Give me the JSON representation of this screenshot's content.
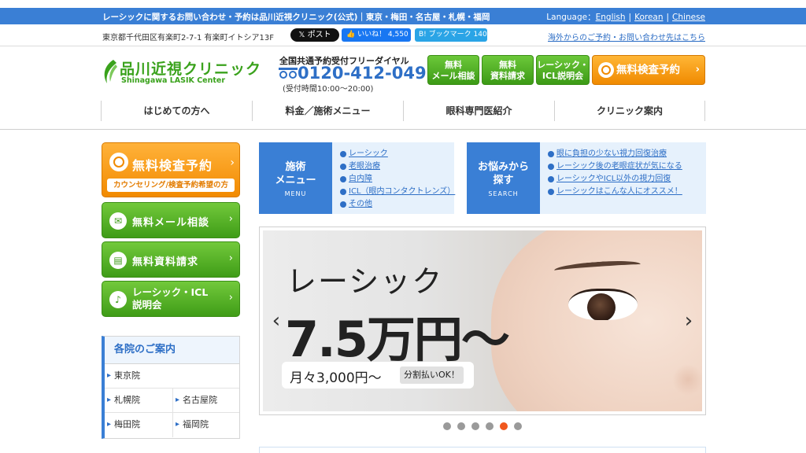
{
  "topbar": {
    "tagline": "レーシックに関するお問い合わせ・予約は品川近視クリニック(公式)｜東京・梅田・名古屋・札幌・福岡",
    "language_label": "Language：",
    "languages": [
      "English",
      "Korean",
      "Chinese"
    ],
    "separator": "|"
  },
  "inforow": {
    "address": "東京都千代田区有楽町2-7-1 有楽町イトシア13F",
    "x_post": "𝕏 ポスト",
    "fb_like": "👍 いいね！ 4,550",
    "hatena": "B! ブックマーク 140",
    "overseas_link": "海外からのご予約・お問い合わせ先はこちら"
  },
  "header": {
    "logo_jp": "品川近視クリニック",
    "logo_en": "Shinagawa LASIK Center",
    "dial_label": "全国共通予約受付フリーダイヤル",
    "dial_number": "0120-412-049",
    "dial_hours": "(受付時間10:00〜20:00)",
    "buttons": [
      {
        "line1": "無料",
        "line2": "メール相談"
      },
      {
        "line1": "無料",
        "line2": "資料請求"
      },
      {
        "line1": "レーシック・",
        "line2": "ICL説明会"
      }
    ],
    "main_button": "無料検査予約",
    "arrow": "›"
  },
  "nav": {
    "items": [
      "はじめての方へ",
      "料金／施術メニュー",
      "眼科専門医紹介",
      "クリニック案内"
    ]
  },
  "sidebar": {
    "main_button": {
      "title": "無料検査予約",
      "sub": "カウンセリング/検査予約希望の方"
    },
    "buttons": [
      {
        "title": "無料メール相談",
        "icon": "✉"
      },
      {
        "title": "無料資料請求",
        "icon": "▤"
      },
      {
        "title1": "レーシック・ICL",
        "title2": "説明会",
        "icon": "♪"
      }
    ],
    "clinics_title": "各院のご案内",
    "clinics": [
      "東京院",
      "札幌院",
      "名古屋院",
      "梅田院",
      "福岡院"
    ]
  },
  "menu_boxes": [
    {
      "label_jp_1": "施術",
      "label_jp_2": "メニュー",
      "label_en": "MENU",
      "items": [
        "レーシック",
        "老眼治療",
        "白内障",
        "ICL（眼内コンタクトレンズ）",
        "その他"
      ]
    },
    {
      "label_jp_1": "お悩みから",
      "label_jp_2": "探す",
      "label_en": "SEARCH",
      "items": [
        "眼に負担の少ない視力回復治療",
        "レーシック後の老眼症状が気になる",
        "レーシックやICL以外の視力回復",
        "レーシックはこんな人にオススメ！"
      ]
    }
  ],
  "banner": {
    "title": "レーシック",
    "price": "7.5万円〜",
    "monthly": "月々3,000円〜",
    "installment": "分割払いOK！",
    "prev": "‹",
    "next": "›",
    "slide_count": 6,
    "active_slide": 5
  },
  "colors": {
    "brand_blue": "#3a7fd5",
    "brand_green": "#3aa21c",
    "cta_orange": "#f28a00",
    "active_dot": "#f0581e"
  }
}
